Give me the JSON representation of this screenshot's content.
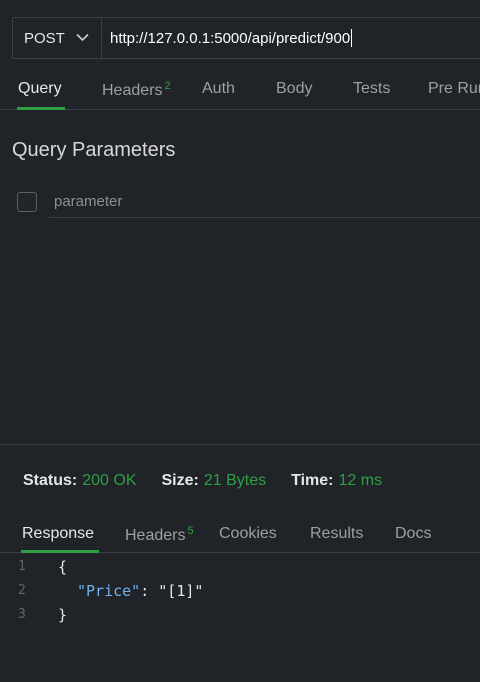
{
  "request": {
    "method": "POST",
    "url": "http://127.0.0.1:5000/api/predict/900"
  },
  "request_tabs": [
    {
      "label": "Query",
      "badge": ""
    },
    {
      "label": "Headers",
      "badge": "2"
    },
    {
      "label": "Auth",
      "badge": ""
    },
    {
      "label": "Body",
      "badge": ""
    },
    {
      "label": "Tests",
      "badge": ""
    },
    {
      "label": "Pre Run",
      "badge": ""
    }
  ],
  "query_params": {
    "title": "Query Parameters",
    "placeholder": "parameter"
  },
  "status": {
    "status_label": "Status:",
    "status_value": "200 OK",
    "size_label": "Size:",
    "size_value": "21 Bytes",
    "time_label": "Time:",
    "time_value": "12 ms"
  },
  "response_tabs": [
    {
      "label": "Response",
      "badge": ""
    },
    {
      "label": "Headers",
      "badge": "5"
    },
    {
      "label": "Cookies",
      "badge": ""
    },
    {
      "label": "Results",
      "badge": ""
    },
    {
      "label": "Docs",
      "badge": ""
    }
  ],
  "response_body": {
    "lines": [
      {
        "n": "1",
        "open": "{"
      },
      {
        "n": "2",
        "key": "\"Price\"",
        "sep": ": ",
        "value": "\"[1]\""
      },
      {
        "n": "3",
        "close": "}"
      }
    ]
  },
  "colors": {
    "accent": "#2ea043",
    "json_key": "#6fb3f0",
    "background": "#202327"
  },
  "icons": {
    "method_dropdown": "chevron-down-icon"
  }
}
